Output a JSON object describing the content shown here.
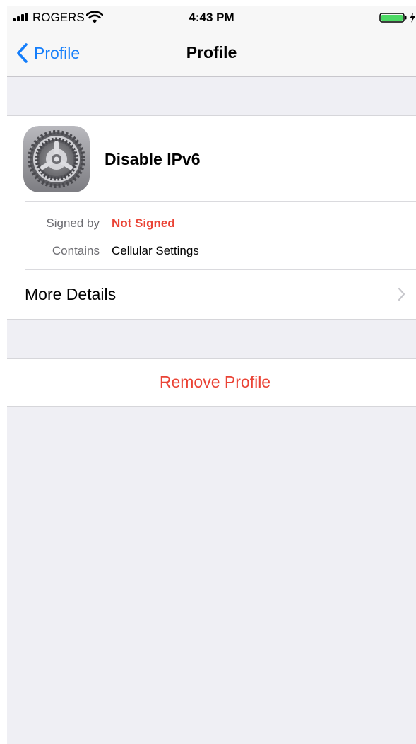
{
  "status_bar": {
    "carrier": "ROGERS",
    "time": "4:43 PM",
    "signal_icon": "signal-bars-icon",
    "wifi_icon": "wifi-icon",
    "battery_icon": "battery-charging-icon"
  },
  "nav": {
    "back_label": "Profile",
    "title": "Profile"
  },
  "profile": {
    "name": "Disable IPv6",
    "icon": "settings-gear-icon",
    "signed_by_label": "Signed by",
    "signed_by_value": "Not Signed",
    "contains_label": "Contains",
    "contains_value": "Cellular Settings",
    "more_details_label": "More Details"
  },
  "actions": {
    "remove_label": "Remove Profile"
  },
  "colors": {
    "accent": "#147efb",
    "destructive": "#ea4335",
    "background": "#efeff4",
    "battery": "#4cd964"
  }
}
